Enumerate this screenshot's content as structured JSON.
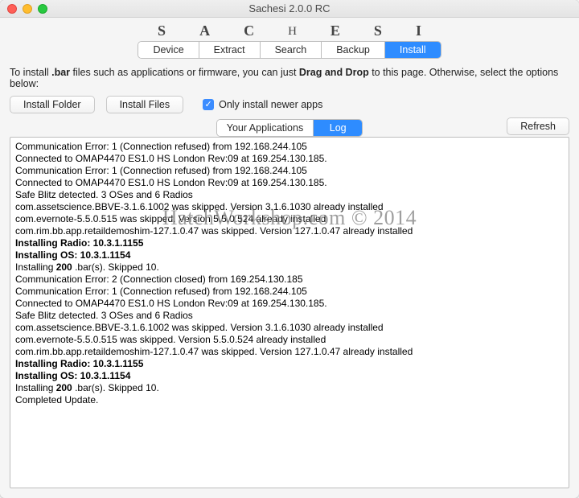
{
  "window": {
    "title": "Sachesi 2.0.0 RC"
  },
  "brand_letters": [
    "S",
    "A",
    "C",
    "H",
    "E",
    "S",
    "I"
  ],
  "main_tabs": {
    "items": [
      "Device",
      "Extract",
      "Search",
      "Backup",
      "Install"
    ],
    "active_index": 4
  },
  "info_line": {
    "pre": "To install ",
    "bar": ".bar",
    "mid": " files such as applications or firmware, you can just ",
    "dnd": "Drag and Drop",
    "post": " to this page. Otherwise, select the options below:"
  },
  "controls": {
    "install_folder": "Install Folder",
    "install_files": "Install Files",
    "checkbox_label": "Only install newer apps",
    "checkbox_checked": true
  },
  "sub_tabs": {
    "items": [
      "Your Applications",
      "Log"
    ],
    "active_index": 1,
    "refresh": "Refresh"
  },
  "log_lines": [
    {
      "t": "Communication Error: 1 (Connection refused) from 192.168.244.105",
      "b": false
    },
    {
      "t": "Connected to OMAP4470 ES1.0 HS London Rev:09 at 169.254.130.185.",
      "b": false
    },
    {
      "t": "Communication Error: 1 (Connection refused) from 192.168.244.105",
      "b": false
    },
    {
      "t": "Connected to OMAP4470 ES1.0 HS London Rev:09 at 169.254.130.185.",
      "b": false
    },
    {
      "t": "Safe Blitz detected. 3 OSes and 6 Radios",
      "b": false
    },
    {
      "t": "com.assetscience.BBVE-3.1.6.1002 was skipped. Version 3.1.6.1030 already installed",
      "b": false
    },
    {
      "t": "com.evernote-5.5.0.515 was skipped. Version 5.5.0.524 already installed",
      "b": false
    },
    {
      "t": "com.rim.bb.app.retaildemoshim-127.1.0.47 was skipped. Version 127.1.0.47 already installed",
      "b": false
    },
    {
      "t": "Installing Radio: 10.3.1.1155",
      "b": true
    },
    {
      "t": "Installing OS: 10.3.1.1154",
      "b": true
    },
    {
      "t": "Installing 200 .bar(s). Skipped 10.",
      "b": false,
      "mixed": [
        "Installing ",
        "200",
        " .bar(s). Skipped 10."
      ]
    },
    {
      "t": "Communication Error: 2 (Connection closed) from 169.254.130.185",
      "b": false
    },
    {
      "t": "Communication Error: 1 (Connection refused) from 192.168.244.105",
      "b": false
    },
    {
      "t": "Connected to OMAP4470 ES1.0 HS London Rev:09 at 169.254.130.185.",
      "b": false
    },
    {
      "t": "Safe Blitz detected. 3 OSes and 6 Radios",
      "b": false
    },
    {
      "t": "com.assetscience.BBVE-3.1.6.1002 was skipped. Version 3.1.6.1030 already installed",
      "b": false
    },
    {
      "t": "com.evernote-5.5.0.515 was skipped. Version 5.5.0.524 already installed",
      "b": false
    },
    {
      "t": "com.rim.bb.app.retaildemoshim-127.1.0.47 was skipped. Version 127.1.0.47 already installed",
      "b": false
    },
    {
      "t": "Installing Radio: 10.3.1.1155",
      "b": true
    },
    {
      "t": "Installing OS: 10.3.1.1154",
      "b": true
    },
    {
      "t": "Installing 200 .bar(s). Skipped 10.",
      "b": false,
      "mixed": [
        "Installing ",
        "200",
        " .bar(s). Skipped 10."
      ]
    },
    {
      "t": "Completed Update.",
      "b": false
    }
  ],
  "watermark": "HatchWorkshop.com © 2014"
}
